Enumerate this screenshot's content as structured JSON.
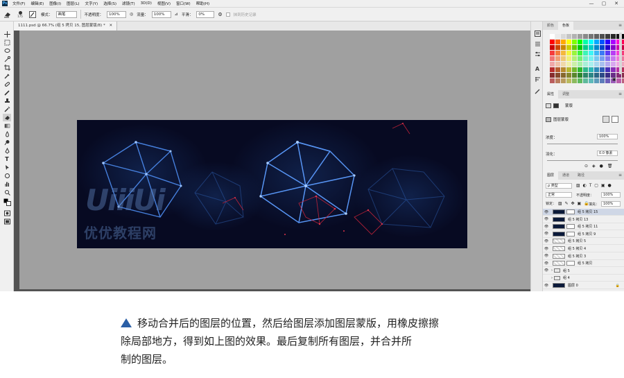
{
  "menu": {
    "logo": "Ps",
    "items": [
      "文件(F)",
      "编辑(E)",
      "图像(I)",
      "图层(L)",
      "文字(Y)",
      "选择(S)",
      "滤镜(T)",
      "3D(D)",
      "视图(V)",
      "窗口(W)",
      "帮助(H)"
    ],
    "window_controls": [
      "—",
      "▢",
      "✕"
    ]
  },
  "options": {
    "brush_size": "175",
    "mode_label": "模式：",
    "mode_value": "画笔",
    "opacity_label": "不透明度：",
    "opacity_value": "100%",
    "flow_label": "流量：",
    "flow_value": "100%",
    "smooth_label": "平滑：",
    "smooth_value": "0%",
    "erase_history_label": "抹到历史记录"
  },
  "document": {
    "tab_title": "1111.psd @ 66.7% (组 5 拷贝 15, 图层蒙版/8) *",
    "tab_close": "✕",
    "watermark_logo": "UiiiUi",
    "watermark_text": "优优教程网"
  },
  "swatches_panel": {
    "tabs": [
      "颜色",
      "色板"
    ],
    "menu_icon": "≡"
  },
  "properties_panel": {
    "tabs": [
      "属性",
      "调整"
    ],
    "menu_icon": "≡",
    "mask_title": "蒙版",
    "layer_mask_label": "图层蒙版",
    "density_label": "浓度：",
    "density_value": "100%",
    "feather_label": "羽化：",
    "feather_value": "0.0 像素"
  },
  "layers_panel": {
    "tabs": [
      "图层",
      "通道",
      "路径"
    ],
    "menu_icon": "≡",
    "filter_type": "ρ 类型",
    "blend_mode": "正常",
    "opacity_label": "不透明度：",
    "opacity_value": "100%",
    "lock_label": "锁定：",
    "fill_label": "填充：",
    "fill_value": "100%",
    "layers": [
      {
        "name": "组 5 拷贝 15",
        "thumb": "dark",
        "mask": true,
        "visible": true,
        "selected": true
      },
      {
        "name": "组 5 拷贝 13",
        "thumb": "dark",
        "mask": false,
        "visible": true,
        "selected": false
      },
      {
        "name": "组 5 拷贝 11",
        "thumb": "dark",
        "mask": true,
        "visible": true,
        "selected": false
      },
      {
        "name": "组 5 拷贝 9",
        "thumb": "dark",
        "mask": true,
        "visible": true,
        "selected": false
      },
      {
        "name": "组 5 拷贝 5",
        "thumb": "check",
        "mask": false,
        "visible": true,
        "selected": false
      },
      {
        "name": "组 5 拷贝 4",
        "thumb": "check",
        "mask": false,
        "visible": true,
        "selected": false
      },
      {
        "name": "组 5 拷贝 3",
        "thumb": "check",
        "mask": false,
        "visible": true,
        "selected": false
      },
      {
        "name": "组 5 拷贝",
        "thumb": "check",
        "mask": true,
        "visible": true,
        "selected": false
      },
      {
        "name": "组 5",
        "thumb": "folder",
        "mask": false,
        "visible": true,
        "selected": false
      },
      {
        "name": "组 4",
        "thumb": "folder",
        "mask": false,
        "visible": false,
        "selected": false
      },
      {
        "name": "图层 0",
        "thumb": "dark",
        "mask": false,
        "visible": true,
        "selected": false,
        "locked": true
      }
    ]
  },
  "caption": {
    "line1": "移动合并后的图层的位置，然后给图层添加图层蒙版，用橡皮擦擦",
    "line2": "除局部地方，得到如上图的效果。最后复制所有图层，并合并所",
    "line3": "制的图层。"
  },
  "colors": {
    "accent": "#2a5fa6",
    "canvas_bg": "#a0a0a0",
    "image_bg": "#070a22"
  }
}
